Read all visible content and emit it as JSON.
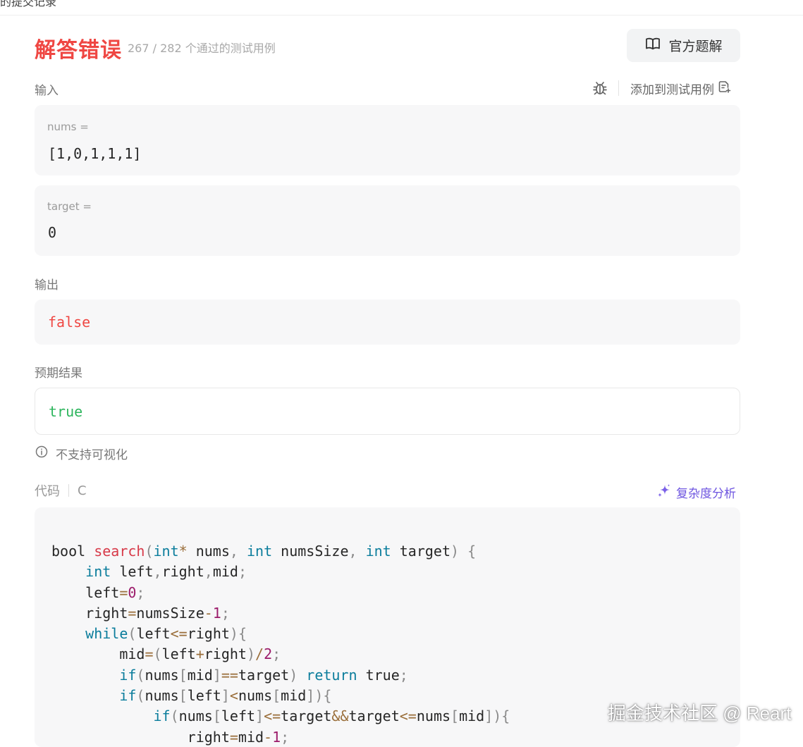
{
  "topbar": {
    "title": "的提交记录",
    "right_fragment": ""
  },
  "result": {
    "status": "解答错误",
    "passed": "267",
    "total": "282",
    "stats_suffix": "个通过的测试用例",
    "status_color": "#ef4743"
  },
  "header": {
    "solution_button": "官方题解",
    "solution_icon": "book-icon"
  },
  "input": {
    "label": "输入",
    "add_test_label": "添加到测试用例",
    "debug_icon": "debug-bug-icon",
    "add_icon": "add-testcase-icon",
    "params": [
      {
        "name": "nums =",
        "value": "[1,0,1,1,1]"
      },
      {
        "name": "target =",
        "value": "0"
      }
    ]
  },
  "output": {
    "label": "输出",
    "value": "false",
    "color": "#ef4743"
  },
  "expected": {
    "label": "预期结果",
    "value": "true",
    "color": "#2db55d"
  },
  "visualization": {
    "text": "不支持可视化",
    "icon": "info-icon"
  },
  "code": {
    "label": "代码",
    "language": "C",
    "complexity_label": "复杂度分析",
    "complexity_icon": "sparkle-icon",
    "complexity_color": "#6e55e0",
    "lines": [
      "bool search(int* nums, int numsSize, int target) {",
      "    int left,right,mid;",
      "    left=0;",
      "    right=numsSize-1;",
      "    while(left<=right){",
      "        mid=(left+right)/2;",
      "        if(nums[mid]==target) return true;",
      "        if(nums[left]<nums[mid]){",
      "            if(nums[left]<=target&&target<=nums[mid]){",
      "                right=mid-1;"
    ]
  },
  "watermark": "掘金技术社区 @ Reart"
}
